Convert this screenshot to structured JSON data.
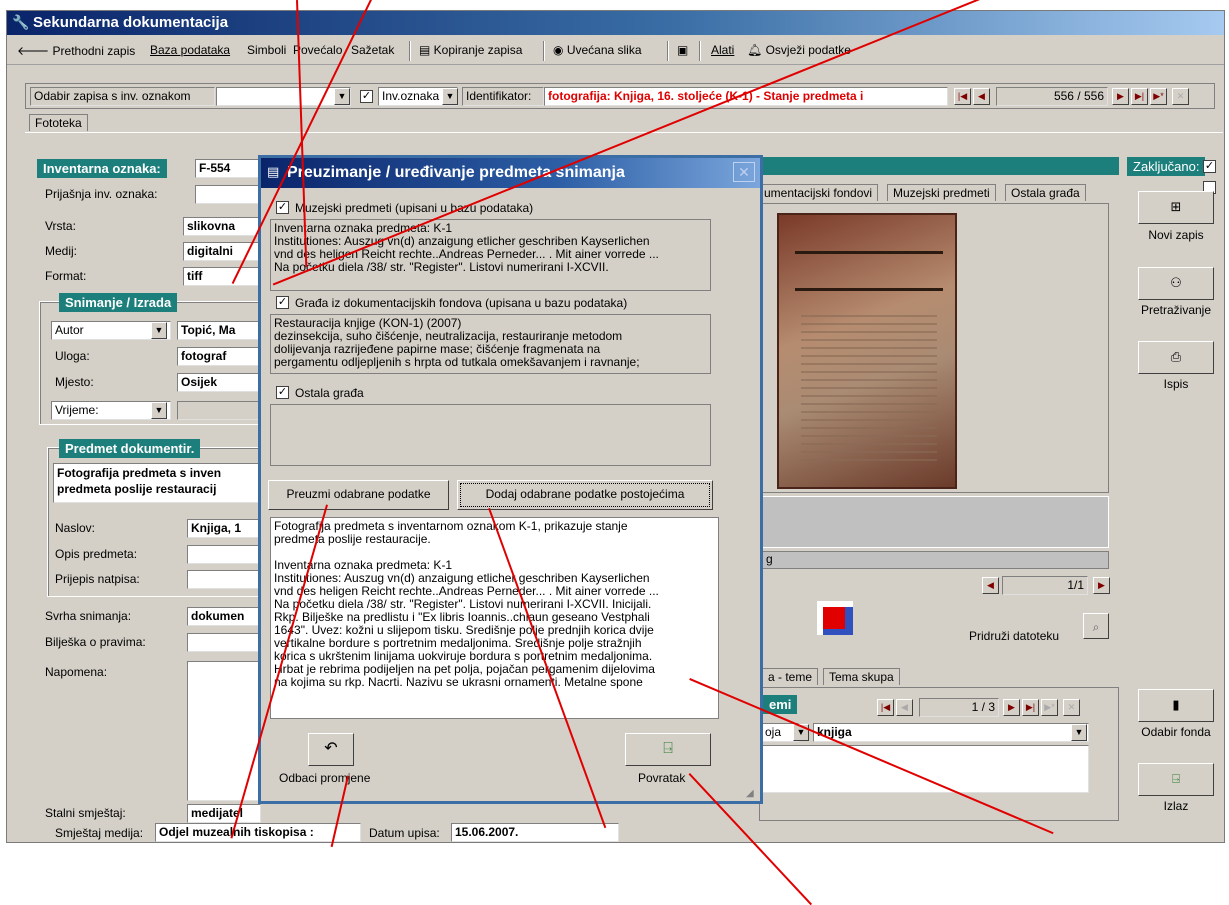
{
  "app": {
    "title": "Sekundarna dokumentacija"
  },
  "toolbar": {
    "prev": "Prethodni zapis",
    "db": "Baza podataka",
    "symbols": "Simboli",
    "magnifier": "Povećalo",
    "summary": "Sažetak",
    "copy": "Kopiranje zapisa",
    "big_image": "Uvećana slika",
    "tools": "Alati",
    "refresh": "Osvježi podatke"
  },
  "record_bar": {
    "select_label": "Odabir zapisa s inv. oznakom",
    "inv_mark_combo": "Inv.oznaka",
    "identifier_label": "Identifikator:",
    "identifier_value": "fotografija: Knjiga, 16. stoljeće (K-1) - Stanje predmeta i",
    "counter": "556 / 556"
  },
  "tab_main": "Fototeka",
  "form": {
    "inv_label": "Inventarna oznaka:",
    "inv_value": "F-554",
    "prev_inv_label": "Prijašnja inv. oznaka:",
    "vrsta_label": "Vrsta:",
    "vrsta_value": "slikovna",
    "medij_label": "Medij:",
    "medij_value": "digitalni",
    "format_label": "Format:",
    "format_value": "tiff",
    "snimanje_header": "Snimanje / Izrada",
    "autor_combo": "Autor",
    "autor_value": "Topić, Ma",
    "uloga_label": "Uloga:",
    "uloga_value": "fotograf",
    "mjesto_label": "Mjesto:",
    "mjesto_value": "Osijek",
    "vrijeme_combo": "Vrijeme:",
    "predmet_header": "Predmet dokumentir.",
    "predmet_text": "Fotografija predmeta s inven predmeta poslije restauracij",
    "naslov_label": "Naslov:",
    "naslov_value": "Knjiga, 1",
    "opis_label": "Opis predmeta:",
    "prijepis_label": "Prijepis natpisa:",
    "svrha_label": "Svrha snimanja:",
    "svrha_value": "dokumen",
    "biljeska_label": "Bilješka o pravima:",
    "napomena_label": "Napomena:",
    "stalni_label": "Stalni smještaj:",
    "stalni_value": "medijatel",
    "smjestaj_label": "Smještaj medija:",
    "smjestaj_value": "Odjel muzealnih tiskopisa :",
    "datum_label": "Datum upisa:",
    "datum_value": "15.06.2007."
  },
  "right": {
    "zakljucano_label": "Zaključano:",
    "tabs": [
      "umentacijski fondovi",
      "Muzejski predmeti",
      "Ostala građa"
    ],
    "file_counter": "1/1",
    "pridruzi": "Pridruži datoteku",
    "file_name": "g",
    "theme_tabs": [
      "a - teme",
      "Tema skupa"
    ],
    "theme_header": "emi",
    "theme_counter": "1 / 3",
    "theme_combo": "oja",
    "theme_value": "knjiga"
  },
  "side": {
    "novi": "Novi zapis",
    "pretrazivanje": "Pretraživanje",
    "ispis": "Ispis",
    "odabir": "Odabir fonda",
    "izlaz": "Izlaz"
  },
  "dialog": {
    "title": "Preuzimanje / uređivanje predmeta snimanja",
    "chk1_label": "Muzejski predmeti (upisani u bazu podataka)",
    "box1": "Inventarna oznaka predmeta: K-1\nInstitutiones: Auszug vn(d) anzaigung etlicher geschriben Kayserlichen\nvnd des heligen Reicht rechte..Andreas Perneder... . Mit ainer vorrede ...\nNa početku diela /38/ str. \"Register\". Listovi numerirani I-XCVII.",
    "chk2_label": "Građa iz dokumentacijskih fondova (upisana u bazu podataka)",
    "box2": "Restauracija knjige (KON-1) (2007)\ndezinsekcija, suho čišćenje, neutralizacija, restauriranje metodom\ndolijevanja razrijeđene papirne mase; čišćenje fragmenata na\npergamentu odljepljenih s hrpta od tutkala omekšavanjem i ravnanje;",
    "chk3_label": "Ostala građa",
    "btn_preuzmi": "Preuzmi odabrane podatke",
    "btn_dodaj": "Dodaj odabrane podatke postojećima",
    "big_text": "Fotografija predmeta s inventarnom oznakom K-1, prikazuje stanje\npredmeta poslije restauracije.\n\nInventarna oznaka predmeta: K-1\nInstitutiones: Auszug vn(d) anzaigung etlicher geschriben Kayserlichen\nvnd des heligen Reicht rechte..Andreas Perneder... . Mit ainer vorrede ...\nNa početku diela /38/ str. \"Register\". Listovi numerirani I-XCVII. Inicijali.\nRkp. Bilješke na predlistu i \"Ex libris Ioannis..chlaun geseano Vestphali\n1643\". Uvez: kožni u slijepom tisku. Središnje polje prednjih korica dvije\nvertikalne bordure s portretnim medaljonima. Središnje polje stražnjih\nkorica s ukrštenim linijama uokviruje bordura s portretnim medaljonima.\nHrbat je rebrima podijeljen na pet polja, pojačan pergamenim dijelovima\nna kojima su rkp. Nacrti. Nazivu se ukrasni ornamenti. Metalne spone",
    "btn_odbaci": "Odbaci promjene",
    "btn_povratak": "Povratak"
  },
  "colors": {
    "teal": "#1c7f7c",
    "title_blue": "#0a246a",
    "identifier_red": "#e00000"
  }
}
